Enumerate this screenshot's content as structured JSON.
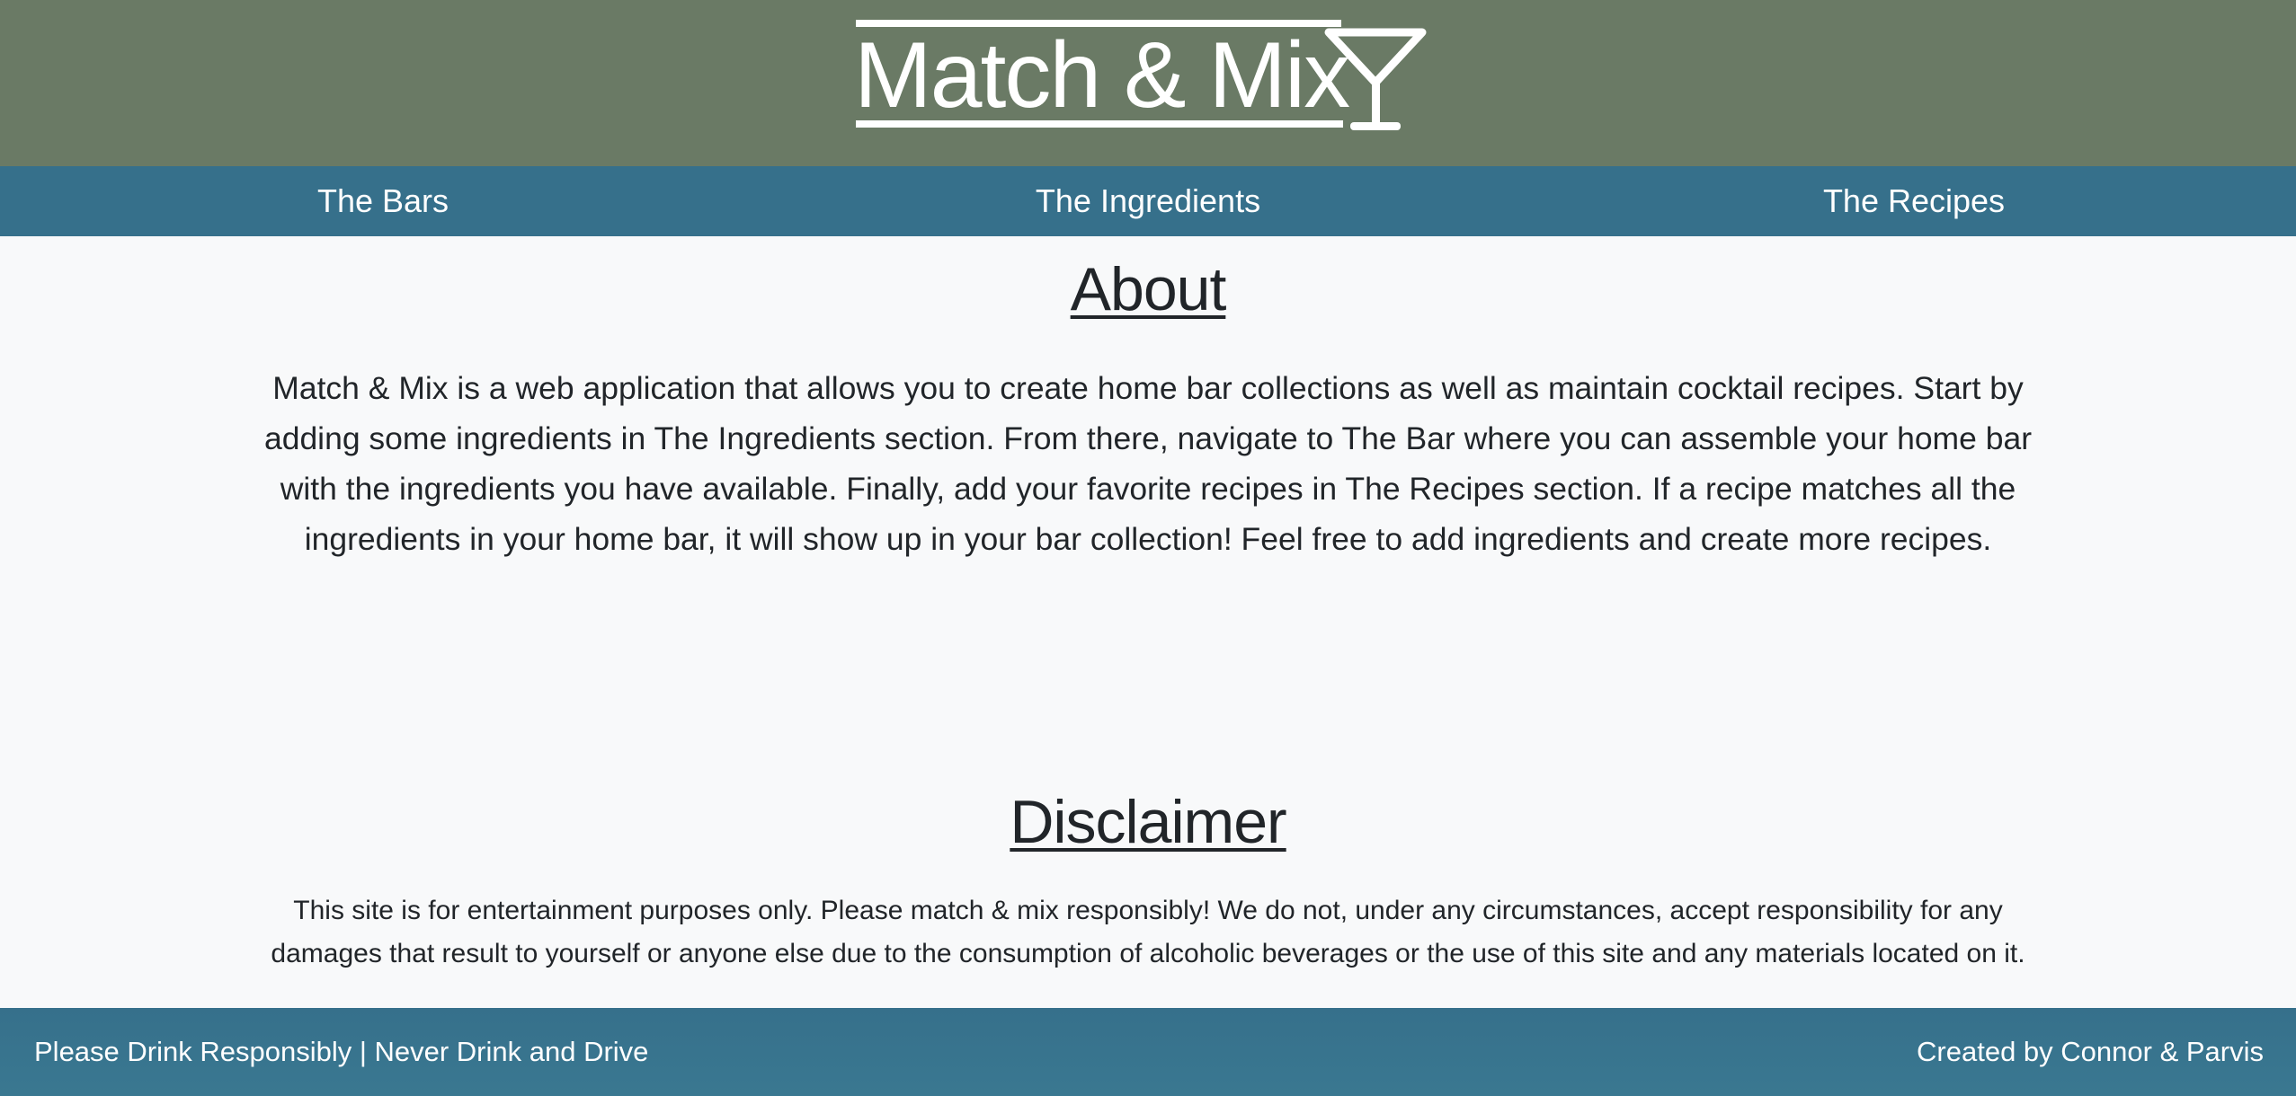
{
  "header": {
    "logo_text": "Match & Mix",
    "logo_icon": "martini-glass-icon",
    "background_color": "#6a7a65"
  },
  "nav": {
    "background_color": "#36708b",
    "items": [
      {
        "label": "The Bars"
      },
      {
        "label": "The Ingredients"
      },
      {
        "label": "The Recipes"
      }
    ]
  },
  "about": {
    "title": "About",
    "body": "Match & Mix is a web application that allows you to create home bar collections as well as maintain cocktail recipes. Start by adding some ingredients in The Ingredients section. From there, navigate to The Bar where you can assemble your home bar with the ingredients you have available. Finally, add your favorite recipes in The Recipes section. If a recipe matches all the ingredients in your home bar, it will show up in your bar collection! Feel free to add ingredients and create more recipes."
  },
  "disclaimer": {
    "title": "Disclaimer",
    "body": "This site is for entertainment purposes only. Please match & mix responsibly! We do not, under any circumstances, accept responsibility for any damages that result to yourself or anyone else due to the consumption of alcoholic beverages or the use of this site and any materials located on it."
  },
  "footer": {
    "left_text": "Please Drink Responsibly | Never Drink and Drive",
    "right_text": "Created by Connor & Parvis"
  }
}
